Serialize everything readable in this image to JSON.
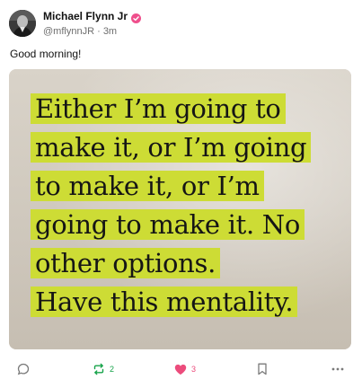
{
  "user": {
    "display_name": "Michael Flynn Jr",
    "handle": "@mflynnJR",
    "separator": "·",
    "time_ago": "3m"
  },
  "post": {
    "text": "Good morning!",
    "image_quote_lines": [
      "Either I’m going to",
      "make it, or I’m going",
      "to make it, or I’m",
      "going to make it. No",
      "other options.",
      "Have this mentality."
    ]
  },
  "actions": {
    "reply_count": "",
    "repost_count": "2",
    "like_count": "3"
  },
  "colors": {
    "verified_badge": "#ef4f8c",
    "repost_green": "#17a34a",
    "like_pink": "#ec4c7c",
    "highlight": "#cddc35",
    "icon_gray": "#7a7a7a"
  }
}
